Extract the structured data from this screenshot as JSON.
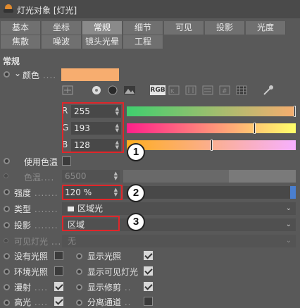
{
  "window": {
    "title": "灯光对象 [灯光]"
  },
  "tabs_row1": [
    "基本",
    "坐标",
    "常规",
    "细节",
    "可见",
    "投影",
    "光度"
  ],
  "tabs_row2": [
    "焦散",
    "噪波",
    "镜头光晕",
    "工程"
  ],
  "active_tab": "常规",
  "section": {
    "title": "常规"
  },
  "color": {
    "label": "颜色",
    "swatch": "#f7ad6f",
    "mode_button": "RGB",
    "tool_icons": [
      "color-wheel-icon",
      "color-spectrum-icon",
      "gradient-icon",
      "image-icon",
      "kelvin-icon",
      "mixer-icon",
      "swatches-icon",
      "hex-icon",
      "grid-icon",
      "eyedropper-icon"
    ],
    "r": {
      "label": "R",
      "value": "255",
      "fraction": 1.0
    },
    "g": {
      "label": "G",
      "value": "193",
      "fraction": 0.757
    },
    "b": {
      "label": "B",
      "value": "128",
      "fraction": 0.502
    }
  },
  "use_temperature": {
    "label": "使用色温",
    "checked": false
  },
  "temperature": {
    "label": "色温",
    "value": "6500"
  },
  "intensity": {
    "label": "强度",
    "value": "120 %",
    "fraction": 1.0
  },
  "type": {
    "label": "类型",
    "value": "区域光"
  },
  "shadow": {
    "label": "投影",
    "value": "区域"
  },
  "visible_light": {
    "label": "可见灯光",
    "value": "无"
  },
  "checks": {
    "no_illumination": {
      "label": "没有光照",
      "checked": false
    },
    "show_illumination": {
      "label": "显示光照",
      "checked": true
    },
    "ambient": {
      "label": "环境光照",
      "checked": false
    },
    "show_visible_light": {
      "label": "显示可见灯光",
      "checked": true
    },
    "diffuse": {
      "label": "漫射",
      "checked": true
    },
    "show_clipping": {
      "label": "显示修剪",
      "checked": true
    },
    "specular": {
      "label": "高光",
      "checked": true
    },
    "separate_pass": {
      "label": "分离通道",
      "checked": false
    }
  },
  "callouts": [
    "1",
    "2",
    "3"
  ],
  "colors": {
    "highlight": "#e0262a",
    "accent_blue": "#4a7fd0"
  }
}
